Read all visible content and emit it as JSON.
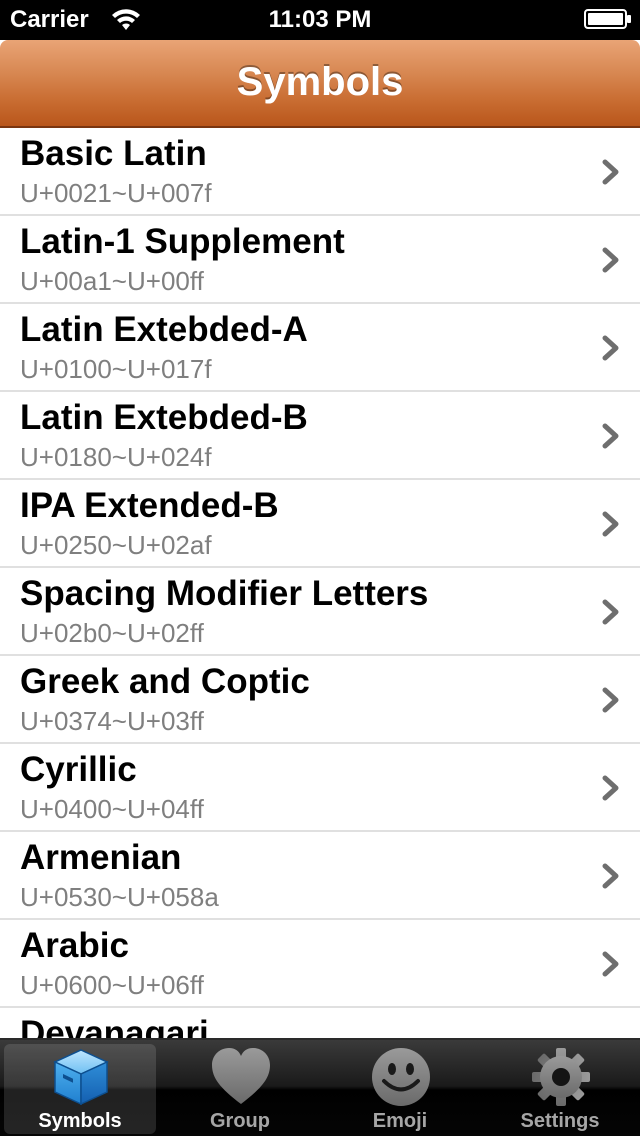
{
  "status_bar": {
    "carrier": "Carrier",
    "time": "11:03 PM"
  },
  "nav_bar": {
    "title": "Symbols",
    "color": "#c96d32"
  },
  "list": {
    "items": [
      {
        "title": "Basic Latin",
        "range": "U+0021~U+007f"
      },
      {
        "title": "Latin-1 Supplement",
        "range": "U+00a1~U+00ff"
      },
      {
        "title": "Latin Extebded-A",
        "range": "U+0100~U+017f"
      },
      {
        "title": "Latin Extebded-B",
        "range": "U+0180~U+024f"
      },
      {
        "title": "IPA Extended-B",
        "range": "U+0250~U+02af"
      },
      {
        "title": "Spacing Modifier Letters",
        "range": "U+02b0~U+02ff"
      },
      {
        "title": "Greek and Coptic",
        "range": "U+0374~U+03ff"
      },
      {
        "title": "Cyrillic",
        "range": "U+0400~U+04ff"
      },
      {
        "title": "Armenian",
        "range": "U+0530~U+058a"
      },
      {
        "title": "Arabic",
        "range": "U+0600~U+06ff"
      },
      {
        "title": "Devanagari",
        "range": ""
      }
    ]
  },
  "tab_bar": {
    "tabs": [
      {
        "label": "Symbols",
        "icon": "box-icon",
        "selected": true
      },
      {
        "label": "Group",
        "icon": "heart-icon",
        "selected": false
      },
      {
        "label": "Emoji",
        "icon": "smiley-icon",
        "selected": false
      },
      {
        "label": "Settings",
        "icon": "gear-icon",
        "selected": false
      }
    ]
  }
}
